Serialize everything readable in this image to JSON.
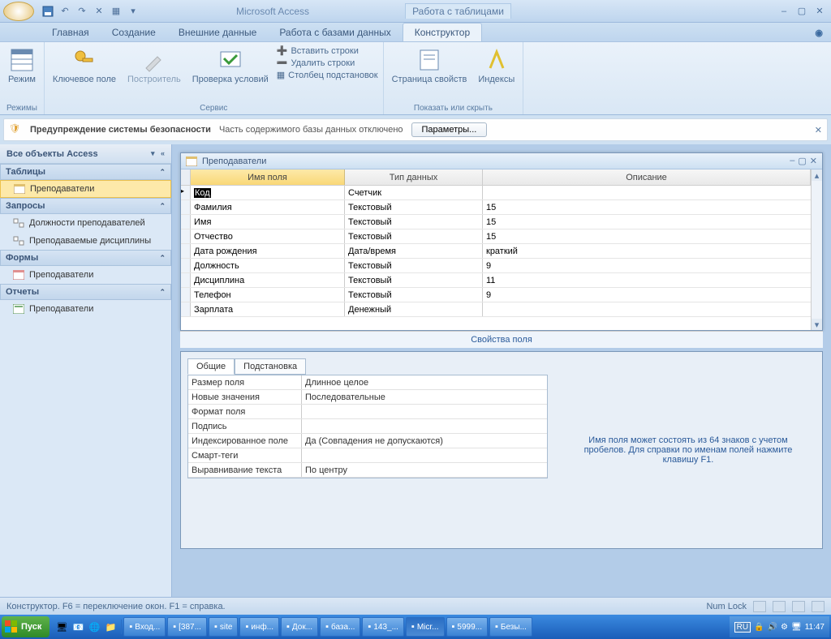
{
  "app": {
    "title": "Microsoft Access",
    "context_tab_group": "Работа с таблицами"
  },
  "tabs": {
    "t1": "Главная",
    "t2": "Создание",
    "t3": "Внешние данные",
    "t4": "Работа с базами данных",
    "t5": "Конструктор"
  },
  "ribbon": {
    "g1": {
      "mode": "Режим",
      "label": "Режимы"
    },
    "g2": {
      "key": "Ключевое поле",
      "builder": "Построитель",
      "check": "Проверка условий",
      "ins": "Вставить строки",
      "del": "Удалить строки",
      "col": "Столбец подстановок",
      "label": "Сервис"
    },
    "g3": {
      "pp": "Страница свойств",
      "idx": "Индексы",
      "label": "Показать или скрыть"
    }
  },
  "security": {
    "bold": "Предупреждение системы безопасности",
    "text": "Часть содержимого базы данных отключено",
    "btn": "Параметры..."
  },
  "nav": {
    "header": "Все объекты Access",
    "cat_tables": "Таблицы",
    "tables": [
      "Преподаватели"
    ],
    "cat_queries": "Запросы",
    "queries": [
      "Должности преподавателей",
      "Преподаваемые дисциплины"
    ],
    "cat_forms": "Формы",
    "forms": [
      "Преподаватели"
    ],
    "cat_reports": "Отчеты",
    "reports": [
      "Преподаватели"
    ]
  },
  "tablewin": {
    "title": "Преподаватели",
    "headers": {
      "name": "Имя поля",
      "type": "Тип данных",
      "desc": "Описание"
    },
    "rows": [
      {
        "name": "Код",
        "type": "Счетчик",
        "desc": ""
      },
      {
        "name": "Фамилия",
        "type": "Текстовый",
        "desc": "15"
      },
      {
        "name": "Имя",
        "type": "Текстовый",
        "desc": "15"
      },
      {
        "name": "Отчество",
        "type": "Текстовый",
        "desc": "15"
      },
      {
        "name": "Дата рождения",
        "type": "Дата/время",
        "desc": "краткий"
      },
      {
        "name": "Должность",
        "type": "Текстовый",
        "desc": "9"
      },
      {
        "name": "Дисциплина",
        "type": "Текстовый",
        "desc": "11"
      },
      {
        "name": "Телефон",
        "type": "Текстовый",
        "desc": "9"
      },
      {
        "name": "Зарплата",
        "type": "Денежный",
        "desc": ""
      }
    ],
    "prop_label": "Свойства поля"
  },
  "props": {
    "tab_general": "Общие",
    "tab_lookup": "Подстановка",
    "rows": [
      {
        "l": "Размер поля",
        "v": "Длинное целое"
      },
      {
        "l": "Новые значения",
        "v": "Последовательные"
      },
      {
        "l": "Формат поля",
        "v": ""
      },
      {
        "l": "Подпись",
        "v": ""
      },
      {
        "l": "Индексированное поле",
        "v": "Да (Совпадения не допускаются)"
      },
      {
        "l": "Смарт-теги",
        "v": ""
      },
      {
        "l": "Выравнивание текста",
        "v": "По центру"
      }
    ],
    "help": "Имя поля может состоять из 64 знаков с учетом пробелов.  Для справки по именам полей нажмите клавишу F1."
  },
  "statusbar": {
    "left": "Конструктор.  F6 = переключение окон.  F1 = справка.",
    "numlock": "Num Lock"
  },
  "taskbar": {
    "start": "Пуск",
    "buttons": [
      "Вход...",
      "[387...",
      "site",
      "инф...",
      "Док...",
      "база...",
      "143_...",
      "Micr...",
      "5999...",
      "Безы..."
    ],
    "lang": "RU",
    "time": "11:47"
  }
}
